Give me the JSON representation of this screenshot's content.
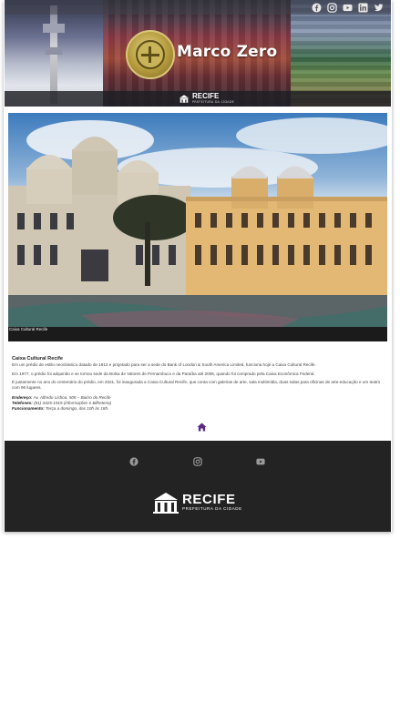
{
  "header": {
    "title": "Marco Zero",
    "logo_text": "RECIFE",
    "logo_subtext": "PREFEITURA DA CIDADE",
    "social_icons": [
      "facebook-icon",
      "instagram-icon",
      "youtube-icon",
      "linkedin-icon",
      "twitter-icon"
    ]
  },
  "photo": {
    "caption": "Caixa Cultural Recife"
  },
  "article": {
    "heading": "Caixa Cultural Recife",
    "paragraphs": [
      "Em um prédio de estilo neoclássico datado de 1912 e projetado para ser a sede do Bank of London & South America Limited, funciona hoje a Caixa Cultural Recife.",
      "Em 1977, o prédio foi adquirido e se tornou sede da Bolsa de Valores de Pernambuco e da Paraíba até 2006, quando foi comprado pela Caixa Econômica Federal.",
      "É justamente no ano do centenário do prédio, em 2021, foi inaugurada a Caixa Cultural Recife, que conta com galerias de arte, sala multimídia, duas salas para oficinas de arte-educação e um teatro com 96 lugares."
    ],
    "address_label": "Endereço:",
    "address_value": "Av. Alfredo Lisboa, 505 – Bairro do Recife",
    "phones_label": "Telefones:",
    "phones_value": "(81) 3425-1915 (informações e Bilheteria)",
    "hours_label": "Funcionamento:",
    "hours_value": "Terça a domingo, das 10h às 18h."
  },
  "nav": {
    "home_icon": "home-icon",
    "home_color": "#5b2a86"
  },
  "footer": {
    "social_icons": [
      "facebook-icon",
      "instagram-icon",
      "youtube-icon"
    ],
    "logo_text": "RECIFE",
    "logo_subtext": "PREFEITURA DA CIDADE"
  },
  "colors": {
    "footer_bg": "#232323",
    "caption_bg": "#1b1b1b",
    "accent": "#5b2a86"
  }
}
